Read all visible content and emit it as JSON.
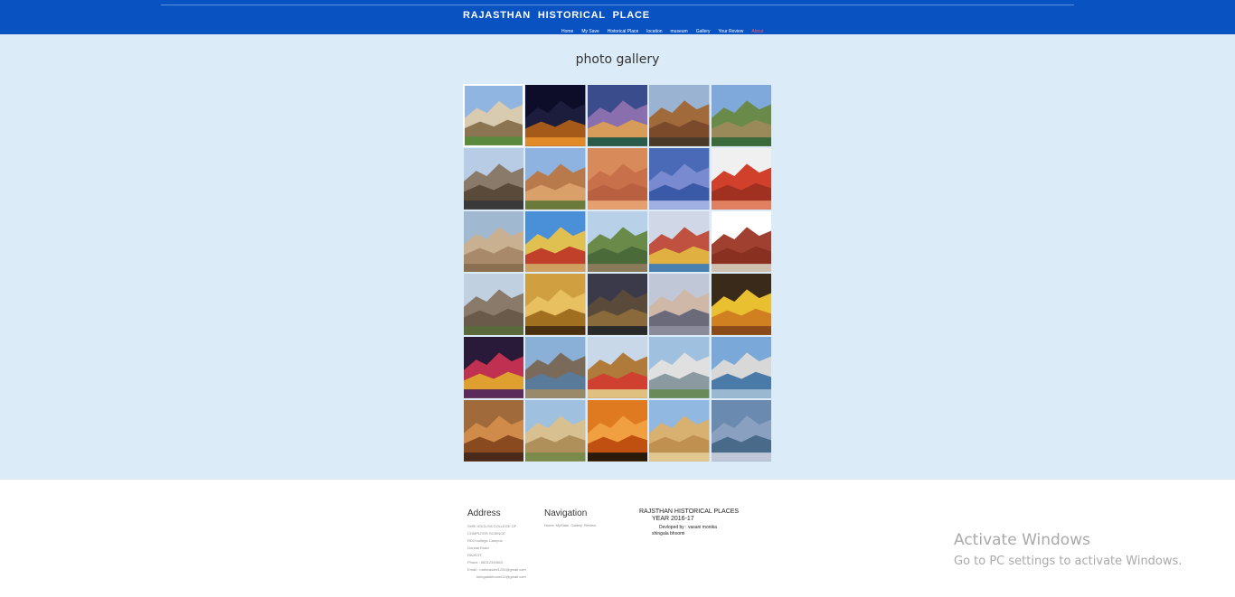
{
  "header": {
    "site_title": "RAJASTHAN HISTORICAL PLACE",
    "nav": [
      "Home",
      "My Save",
      "Historical Place",
      "location",
      "museum",
      "Gallery",
      "Your Review",
      "About"
    ],
    "active_nav": "About"
  },
  "main": {
    "title": "photo gallery",
    "photos": [
      {
        "name": "palace-white-dome",
        "colors": [
          "#8fb5e0",
          "#d9cbb0",
          "#8a7452",
          "#5b8a3e"
        ]
      },
      {
        "name": "city-at-night",
        "colors": [
          "#0d0d2a",
          "#1c1c3c",
          "#a55a1a",
          "#e08a2a"
        ]
      },
      {
        "name": "palace-lit-dusk",
        "colors": [
          "#3a4c8c",
          "#8a6fae",
          "#d79b5a",
          "#2a5a4a"
        ]
      },
      {
        "name": "fort-on-hill",
        "colors": [
          "#9ab3d2",
          "#a06a3a",
          "#7a4a2a",
          "#4a3a2a"
        ]
      },
      {
        "name": "fort-lake-aerial",
        "colors": [
          "#7fa9da",
          "#6a8a4a",
          "#9a8a5a",
          "#3a6a3a"
        ]
      },
      {
        "name": "palace-ornate-grey",
        "colors": [
          "#b8cce6",
          "#8a7a6a",
          "#5a4a3a",
          "#3a3a3a"
        ]
      },
      {
        "name": "museum-building",
        "colors": [
          "#8fb3e0",
          "#b87a4a",
          "#d9a06a",
          "#6a7a3a"
        ]
      },
      {
        "name": "hawa-mahal",
        "colors": [
          "#d98a5a",
          "#c8704a",
          "#b86040",
          "#e6a070"
        ]
      },
      {
        "name": "blue-city",
        "colors": [
          "#4a6ab8",
          "#7a8ad0",
          "#3a5aa8",
          "#a0b0e0"
        ]
      },
      {
        "name": "temple-carved",
        "colors": [
          "#f0f0f0",
          "#d0402a",
          "#a03020",
          "#e08060"
        ]
      },
      {
        "name": "city-aerial",
        "colors": [
          "#a0b8d0",
          "#c8b090",
          "#a88a6a",
          "#8a7050"
        ]
      },
      {
        "name": "decorated-camel",
        "colors": [
          "#4a90d8",
          "#e0c050",
          "#c0402a",
          "#d0a060"
        ]
      },
      {
        "name": "fort-cliffs",
        "colors": [
          "#b8d0e8",
          "#6a8a4a",
          "#4a6a3a",
          "#8a7a5a"
        ]
      },
      {
        "name": "festival-crowd",
        "colors": [
          "#d0d8e8",
          "#c05040",
          "#e0b040",
          "#4a80b0"
        ]
      },
      {
        "name": "museum-red-facade",
        "colors": [
          "#ffffff",
          "#a04030",
          "#8a3020",
          "#d0c0b0"
        ]
      },
      {
        "name": "fort-hilltop",
        "colors": [
          "#c0d0e0",
          "#8a7a6a",
          "#6a5a4a",
          "#5a6a3a"
        ]
      },
      {
        "name": "golden-palace-night",
        "colors": [
          "#d0a040",
          "#e8c060",
          "#a07020",
          "#4a3010"
        ]
      },
      {
        "name": "dusk-skyline",
        "colors": [
          "#3a3a4a",
          "#5a4a3a",
          "#8a6a3a",
          "#2a2a2a"
        ]
      },
      {
        "name": "lake-ghats",
        "colors": [
          "#c0c8d8",
          "#d0b8a8",
          "#6a6a7a",
          "#8a8a9a"
        ]
      },
      {
        "name": "dancer-yellow",
        "colors": [
          "#3a2a1a",
          "#e8c030",
          "#d08020",
          "#8a4a1a"
        ]
      },
      {
        "name": "night-festival",
        "colors": [
          "#2a1a3a",
          "#c03050",
          "#e0a030",
          "#5a2a5a"
        ]
      },
      {
        "name": "fort-over-city",
        "colors": [
          "#8ab0d8",
          "#7a6a5a",
          "#5a7a9a",
          "#9a8a6a"
        ]
      },
      {
        "name": "camel-fair",
        "colors": [
          "#c8d8e8",
          "#b07a3a",
          "#d04030",
          "#e0c080"
        ]
      },
      {
        "name": "lake-palace-white",
        "colors": [
          "#a0c0e0",
          "#e0e0e0",
          "#8a9aa0",
          "#6a8a5a"
        ]
      },
      {
        "name": "city-palace-lake",
        "colors": [
          "#7aa8d8",
          "#d8d8d8",
          "#4a7aa8",
          "#9ab8d0"
        ]
      },
      {
        "name": "fort-sunset-glow",
        "colors": [
          "#a06a3a",
          "#d08a4a",
          "#8a4a20",
          "#4a2a1a"
        ]
      },
      {
        "name": "palace-jaisalmer",
        "colors": [
          "#a0c0e0",
          "#d8c090",
          "#b0905a",
          "#7a8a4a"
        ]
      },
      {
        "name": "desert-sunset-camels",
        "colors": [
          "#e07a20",
          "#f0a040",
          "#c05010",
          "#2a1a0a"
        ]
      },
      {
        "name": "havelis-golden",
        "colors": [
          "#90b8e0",
          "#d8b070",
          "#c09050",
          "#e0c890"
        ]
      },
      {
        "name": "mount-abu-aerial",
        "colors": [
          "#6a8ab0",
          "#8aa0c0",
          "#4a6a8a",
          "#c0c8d8"
        ]
      }
    ]
  },
  "footer": {
    "address_heading": "Address",
    "address_lines": [
      "SHRI VDOLIYA COLLEGE OF",
      "COMPUTER SCIENCE",
      "RDO college Campus",
      "Gondal Road",
      "RAJKOT,",
      "Phone : 08312345620",
      "Email : mahivasani1234@gmail.com",
      "shingalabhoomi12@gmail.com"
    ],
    "navigation_heading": "Navigation",
    "navigation_links": [
      "Home",
      "MyState",
      "Gallery",
      "Review"
    ],
    "info_title": "RAJSTHAN HISTORICAL PLACES",
    "info_year": "YEAR 2016-17",
    "developed_by": "Devloped by : vasani monika",
    "developer2": "shingala bhoomi"
  },
  "os_overlay": {
    "line1": "Activate Windows",
    "line2": "Go to PC settings to activate Windows."
  }
}
